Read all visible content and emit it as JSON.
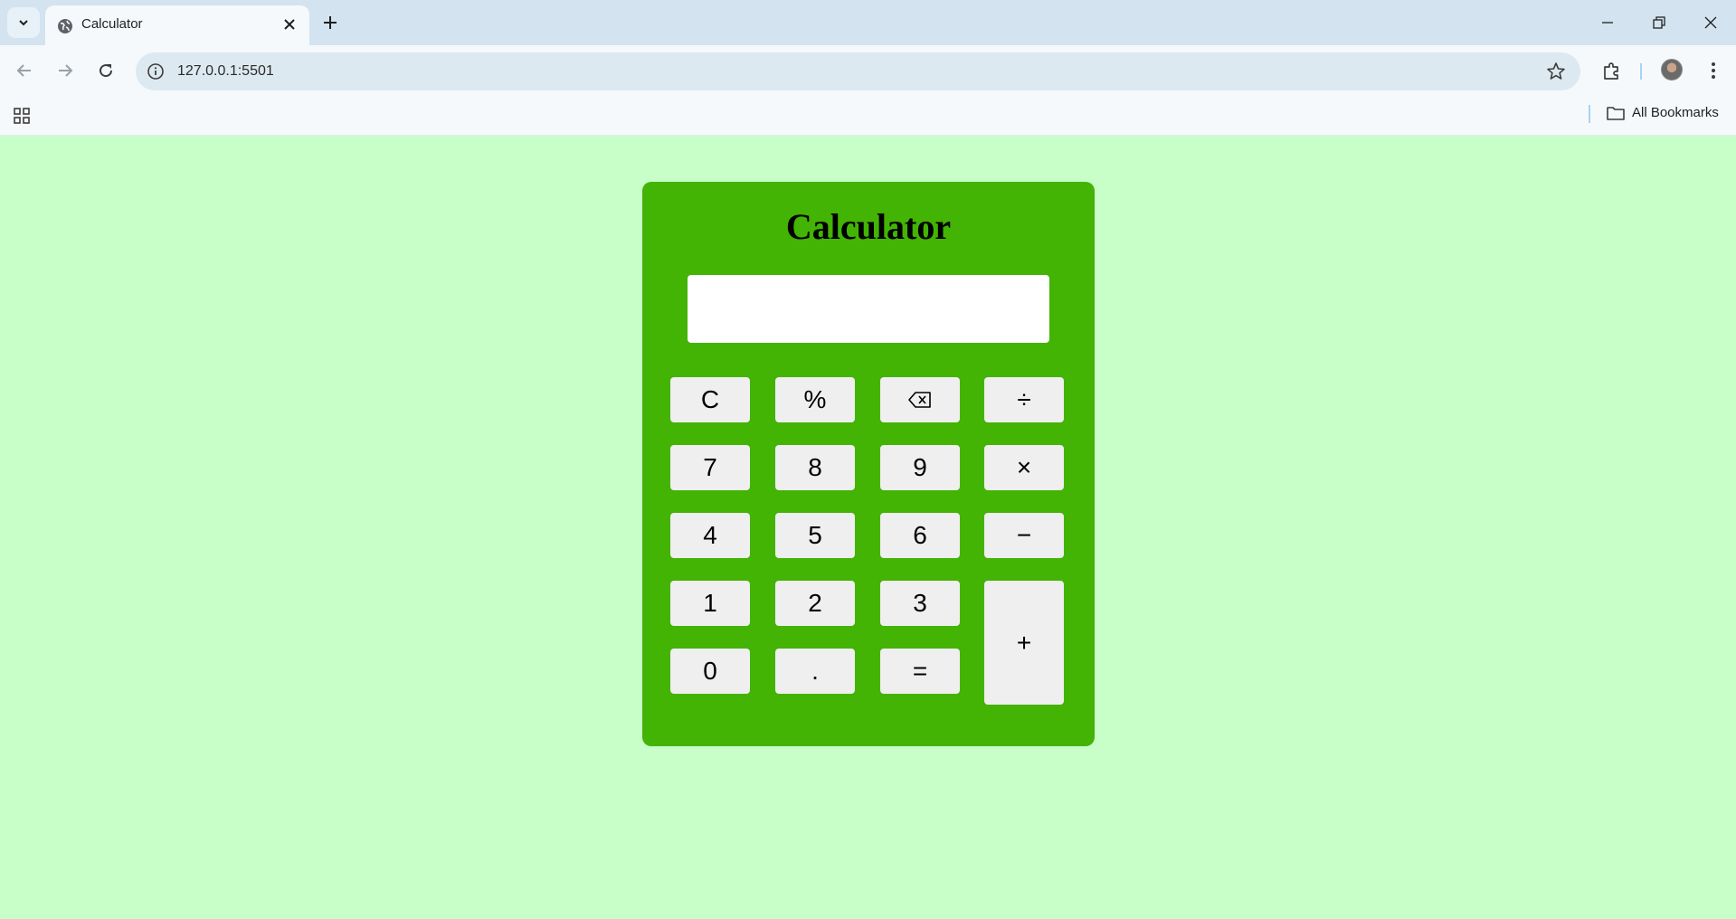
{
  "browser": {
    "tab_title": "Calculator",
    "url": "127.0.0.1:5501",
    "bookmarks_label": "All Bookmarks"
  },
  "calculator": {
    "title": "Calculator",
    "display_value": "",
    "keys": {
      "clear": "C",
      "percent": "%",
      "backspace_icon": "backspace-icon",
      "divide": "÷",
      "seven": "7",
      "eight": "8",
      "nine": "9",
      "multiply": "×",
      "four": "4",
      "five": "5",
      "six": "6",
      "minus": "−",
      "one": "1",
      "two": "2",
      "three": "3",
      "plus": "+",
      "zero": "0",
      "decimal": ".",
      "equals": "="
    }
  },
  "colors": {
    "page_background": "#c8fec8",
    "calculator_background": "#43b304",
    "key_background": "#efefef",
    "display_background": "#ffffff"
  }
}
